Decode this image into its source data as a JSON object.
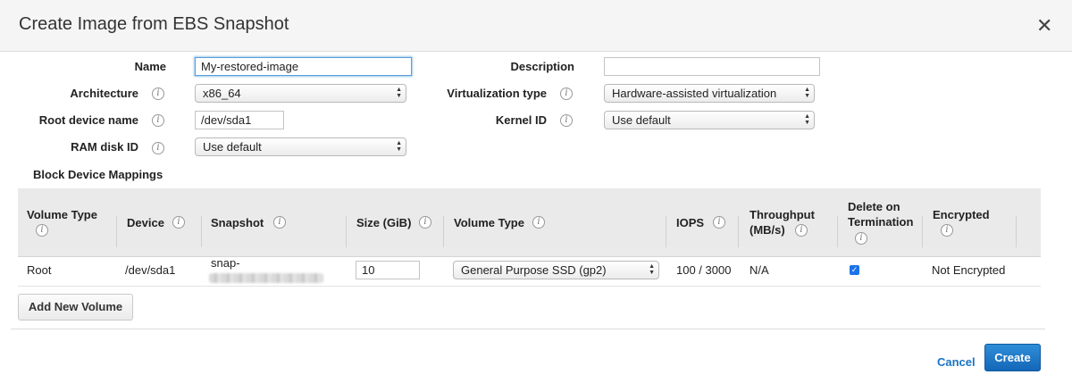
{
  "dialog": {
    "title": "Create Image from EBS Snapshot",
    "close_icon": "✕"
  },
  "form": {
    "name_label": "Name",
    "name_value": "My-restored-image",
    "description_label": "Description",
    "description_value": "",
    "architecture_label": "Architecture",
    "architecture_value": "x86_64",
    "virtualization_label": "Virtualization type",
    "virtualization_value": "Hardware-assisted virtualization",
    "root_device_label": "Root device name",
    "root_device_value": "/dev/sda1",
    "kernel_label": "Kernel ID",
    "kernel_value": "Use default",
    "ramdisk_label": "RAM disk ID",
    "ramdisk_value": "Use default"
  },
  "block_device": {
    "heading": "Block Device Mappings",
    "columns": {
      "volume_type_1": "Volume Type",
      "device": "Device",
      "snapshot": "Snapshot",
      "size": "Size (GiB)",
      "volume_type_2": "Volume Type",
      "iops": "IOPS",
      "throughput_1": "Throughput",
      "throughput_2": "(MB/s)",
      "delete_1": "Delete on",
      "delete_2": "Termination",
      "encrypted": "Encrypted"
    },
    "rows": [
      {
        "volume_type": "Root",
        "device": "/dev/sda1",
        "snapshot_prefix": "snap-",
        "size": "10",
        "ebs_volume_type": "General Purpose SSD (gp2)",
        "iops": "100 / 3000",
        "throughput": "N/A",
        "delete_on_termination": true,
        "encrypted": "Not Encrypted"
      }
    ],
    "add_button": "Add New Volume"
  },
  "footer": {
    "cancel_label": "Cancel",
    "create_label": "Create"
  },
  "icons": {
    "info": "i",
    "select_arrows": "up-down",
    "checkmark": "✓"
  },
  "colors": {
    "primary": "#1a6fc4",
    "link": "#1a73c6",
    "header_bg": "#f5f5f5",
    "table_header_bg": "#eaeaea"
  }
}
